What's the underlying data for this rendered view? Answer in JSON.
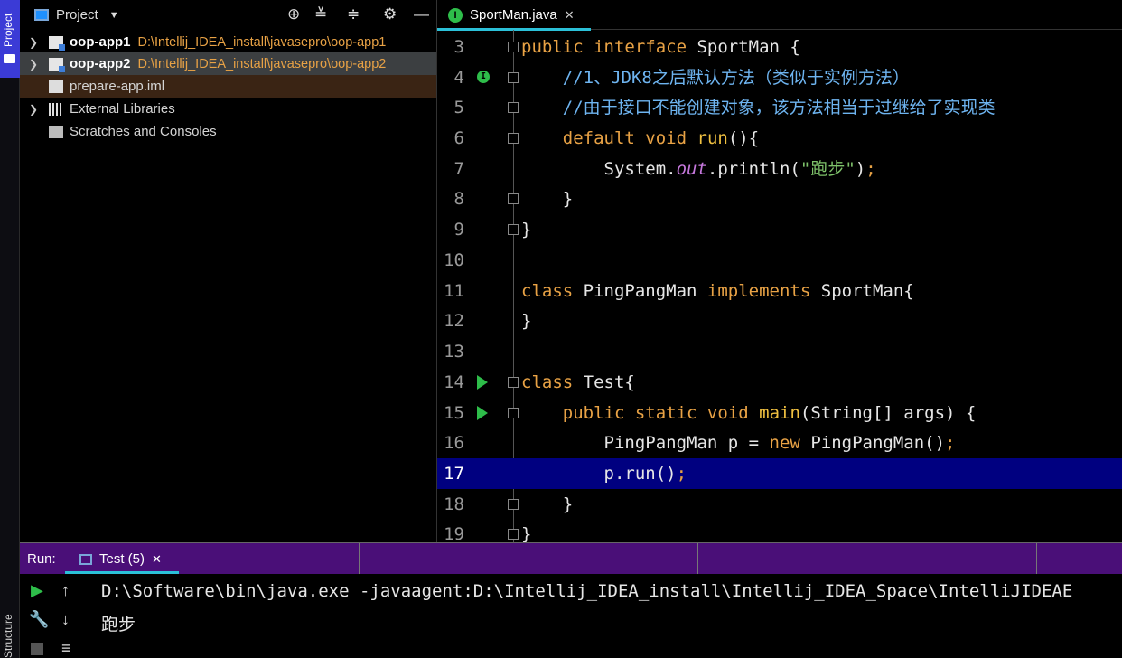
{
  "sidebar": {
    "project_tab": "Project",
    "structure_tab": "Structure"
  },
  "project_panel": {
    "title": "Project",
    "tree": [
      {
        "name": "oop-app1",
        "path": "D:\\Intellij_IDEA_install\\javasepro\\oop-app1"
      },
      {
        "name": "oop-app2",
        "path": "D:\\Intellij_IDEA_install\\javasepro\\oop-app2"
      },
      {
        "name": "prepare-app.iml"
      },
      {
        "name": "External Libraries"
      },
      {
        "name": "Scratches and Consoles"
      }
    ]
  },
  "editor": {
    "tab_label": "SportMan.java",
    "line_numbers": [
      "3",
      "4",
      "5",
      "6",
      "7",
      "8",
      "9",
      "10",
      "11",
      "12",
      "13",
      "14",
      "15",
      "16",
      "17",
      "18",
      "19"
    ],
    "current_line": "17"
  },
  "run": {
    "label": "Run:",
    "tab_label": "Test (5)",
    "output": [
      "D:\\Software\\bin\\java.exe -javaagent:D:\\Intellij_IDEA_install\\Intellij_IDEA_Space\\IntelliJIDEAE",
      "跑步"
    ]
  },
  "colors": {
    "accent": "#2bc0d8",
    "keyword": "#e8a245",
    "comment": "#6eb4f0",
    "run_bar": "#4a0f78",
    "current_line_bg": "#000080"
  }
}
